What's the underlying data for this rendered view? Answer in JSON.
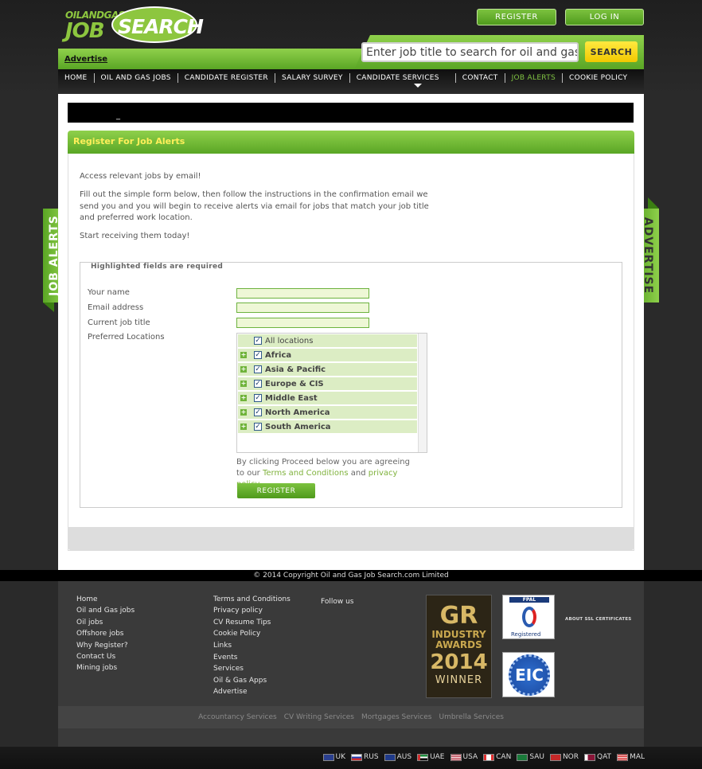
{
  "header": {
    "logo_small": "OILANDGAS",
    "logo_job": "JOB",
    "logo_search": "SEARCH",
    "register_label": "REGISTER",
    "login_label": "LOG IN",
    "advertise_link": "Advertise",
    "search_placeholder": "Enter job title to search for oil and gas jobs",
    "search_button": "SEARCH"
  },
  "nav": {
    "items": [
      {
        "label": "HOME"
      },
      {
        "label": "OIL AND GAS JOBS"
      },
      {
        "label": "CANDIDATE REGISTER"
      },
      {
        "label": "SALARY SURVEY"
      },
      {
        "label": "CANDIDATE SERVICES"
      },
      {
        "label": "CONTACT"
      },
      {
        "label": "JOB ALERTS"
      },
      {
        "label": "COOKIE POLICY"
      }
    ]
  },
  "side_tabs": {
    "left": "JOB ALERTS",
    "right": "ADVERTISE"
  },
  "main": {
    "black_bar_text": "_",
    "section_title": "Register For Job Alerts",
    "intro_1": "Access relevant jobs by email!",
    "intro_2": "Fill out the simple form below, then follow the instructions in the confirmation email we send you and you will begin to receive alerts via email for jobs that match your job title and preferred work location.",
    "intro_3": "Start receiving them today!",
    "legend": "Highlighted fields are required",
    "fields": {
      "name_label": "Your name",
      "email_label": "Email address",
      "job_title_label": "Current job title",
      "locations_label": "Preferred Locations"
    },
    "locations": [
      {
        "label": "All locations",
        "checked": true,
        "expandable": false
      },
      {
        "label": "Africa",
        "checked": true,
        "expandable": true
      },
      {
        "label": "Asia & Pacific",
        "checked": true,
        "expandable": true
      },
      {
        "label": "Europe & CIS",
        "checked": true,
        "expandable": true
      },
      {
        "label": "Middle East",
        "checked": true,
        "expandable": true
      },
      {
        "label": "North America",
        "checked": true,
        "expandable": true
      },
      {
        "label": "South America",
        "checked": true,
        "expandable": true
      }
    ],
    "agree_prefix": "By clicking Proceed below you are agreeing to our",
    "terms_link": "Terms and Conditions",
    "agree_and": "and",
    "privacy_link": "privacy policy",
    "register_button": "REGISTER"
  },
  "footer": {
    "copyright": "© 2014 Copyright Oil and Gas Job Search.com Limited",
    "col1": [
      "Home",
      "Oil and Gas jobs",
      "Oil jobs",
      "Offshore jobs",
      "Why Register?",
      "Contact Us",
      "Mining jobs"
    ],
    "col2a": [
      "Terms and Conditions",
      "Privacy policy",
      "CV Resume Tips",
      "Cookie Policy",
      "Links"
    ],
    "col2b": [
      "Events",
      "Services",
      "Oil & Gas Apps",
      "Advertise"
    ],
    "follow_us": "Follow us",
    "award": {
      "gr": "GR",
      "line1": "INDUSTRY",
      "line2": "AWARDS",
      "year": "2014",
      "winner": "WINNER"
    },
    "fpal": {
      "title": "FPAL",
      "registered": "Registered"
    },
    "eic": "EIC",
    "ssl": "ABOUT SSL CERTIFICATES",
    "services": [
      "Accountancy Services",
      "CV Writing Services",
      "Mortgages Services",
      "Umbrella Services"
    ],
    "countries": [
      {
        "code": "UK",
        "color": "#2a3f8f"
      },
      {
        "code": "RUS",
        "color": "#d32f2f"
      },
      {
        "code": "AUS",
        "color": "#1f3a8a"
      },
      {
        "code": "UAE",
        "color": "#1e8e3e"
      },
      {
        "code": "USA",
        "color": "#b22234"
      },
      {
        "code": "CAN",
        "color": "#e03030"
      },
      {
        "code": "SAU",
        "color": "#1a7a3a"
      },
      {
        "code": "NOR",
        "color": "#c62828"
      },
      {
        "code": "QAT",
        "color": "#8a1538"
      },
      {
        "code": "MAL",
        "color": "#cc0001"
      }
    ]
  },
  "colors": {
    "brand_green": "#6fb33a",
    "accent_yellow": "#f2c800",
    "link_green": "#7fb23c"
  }
}
